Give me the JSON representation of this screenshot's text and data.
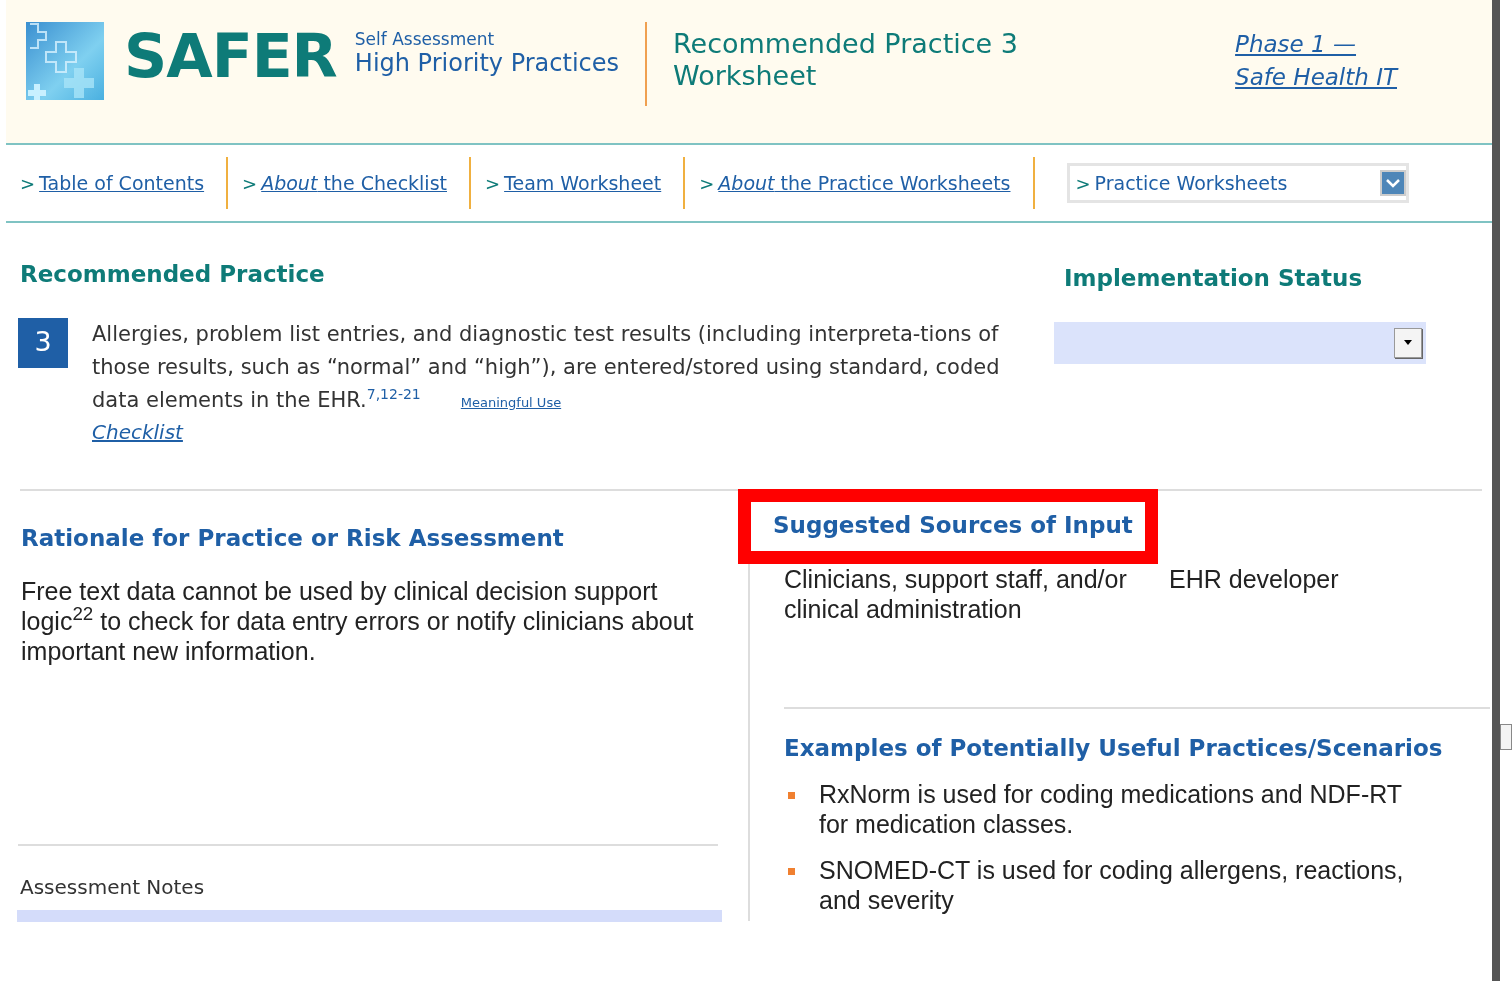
{
  "header": {
    "logo_text": "SAFER",
    "subtitle_small": "Self Assessment",
    "subtitle": "High Priority Practices",
    "title_lines": [
      "Recommended Practice 3",
      "Worksheet"
    ],
    "phase_lines": [
      "Phase 1 —",
      "Safe Health IT"
    ]
  },
  "nav": [
    {
      "kind": "link",
      "marker": ">",
      "label": "Table of Contents"
    },
    {
      "kind": "link",
      "marker": ">",
      "label": "*About* the Checklist"
    },
    {
      "kind": "link",
      "marker": ">",
      "label": "Team Worksheet"
    },
    {
      "kind": "link",
      "marker": ">",
      "label": "*About* the Practice Worksheets"
    },
    {
      "kind": "dropdown",
      "marker": ">",
      "label": "Practice Worksheets"
    }
  ],
  "recommended_practice": {
    "heading": "Recommended Practice",
    "number": "3",
    "text": "Allergies, problem list entries, and diagnostic test results (including interpreta-tions of those results, such as “normal” and “high”), are entered/stored using standard, coded data elements in the EHR.",
    "references": "7,12-21",
    "tag": "Meaningful Use",
    "checklist_link": "Checklist"
  },
  "implementation_status": {
    "heading": "Implementation Status"
  },
  "rationale": {
    "heading": "Rationale for Practice or Risk Assessment",
    "text": "Free text data cannot be used by clinical decision support logic$^{22}$ to check for data entry errors or notify clinicians about important new information."
  },
  "suggested_sources": {
    "heading": "Suggested Sources of Input",
    "highlighted": true,
    "items": [
      "Clinicians, support staff, and/or clinical administration",
      "EHR developer"
    ]
  },
  "examples": {
    "heading": "Examples of Potentially Useful Practices/Scenarios",
    "items": [
      "RxNorm is used for coding medications and NDF-RT for medication classes.",
      "SNOMED-CT is used for coding allergens, reactions, and severity"
    ]
  },
  "assessment_notes": {
    "label": "Assessment Notes"
  }
}
